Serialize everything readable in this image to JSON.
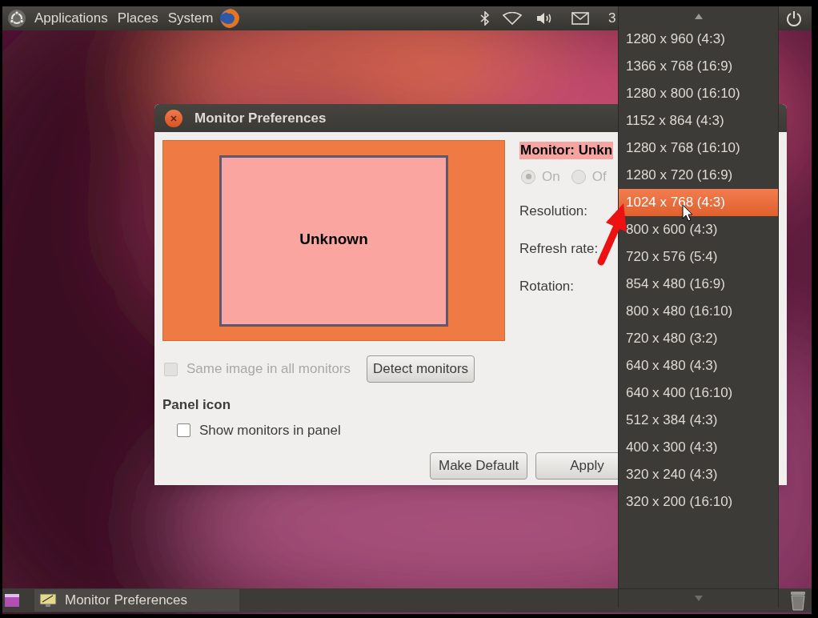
{
  "top_panel": {
    "menus": [
      "Applications",
      "Places",
      "System"
    ],
    "indicator_text": "3"
  },
  "dialog": {
    "title": "Monitor Preferences",
    "monitor_name": "Unknown",
    "monitor_heading": "Monitor: Unkn",
    "power_options": [
      {
        "label": "On",
        "selected": true,
        "disabled": true
      },
      {
        "label": "Of",
        "selected": false,
        "disabled": true
      }
    ],
    "setting_labels": [
      "Resolution:",
      "Refresh rate:",
      "Rotation:"
    ],
    "same_image": {
      "label": "Same image in all monitors",
      "checked": false,
      "disabled": true
    },
    "detect_button": "Detect monitors",
    "panel_icon_heading": "Panel icon",
    "show_in_panel": {
      "label": "Show monitors in panel",
      "checked": false,
      "disabled": false
    },
    "buttons": [
      "Make Default",
      "Apply"
    ]
  },
  "resolution_menu": {
    "items": [
      {
        "label": "1280 x 960 (4:3)",
        "selected": false
      },
      {
        "label": "1366 x 768 (16:9)",
        "selected": false
      },
      {
        "label": "1280 x 800 (16:10)",
        "selected": false
      },
      {
        "label": "1152 x 864 (4:3)",
        "selected": false
      },
      {
        "label": "1280 x 768 (16:10)",
        "selected": false
      },
      {
        "label": "1280 x 720 (16:9)",
        "selected": false
      },
      {
        "label": "1024 x 768 (4:3)",
        "selected": true
      },
      {
        "label": "800 x 600 (4:3)",
        "selected": false
      },
      {
        "label": "720 x 576 (5:4)",
        "selected": false
      },
      {
        "label": "854 x 480 (16:9)",
        "selected": false
      },
      {
        "label": "800 x 480 (16:10)",
        "selected": false
      },
      {
        "label": "720 x 480 (3:2)",
        "selected": false
      },
      {
        "label": "640 x 480 (4:3)",
        "selected": false
      },
      {
        "label": "640 x 400 (16:10)",
        "selected": false
      },
      {
        "label": "512 x 384 (4:3)",
        "selected": false
      },
      {
        "label": "400 x 300 (4:3)",
        "selected": false
      },
      {
        "label": "320 x 240 (4:3)",
        "selected": false
      },
      {
        "label": "320 x 200 (16:10)",
        "selected": false
      }
    ]
  },
  "bottom_panel": {
    "task": "Monitor Preferences"
  }
}
